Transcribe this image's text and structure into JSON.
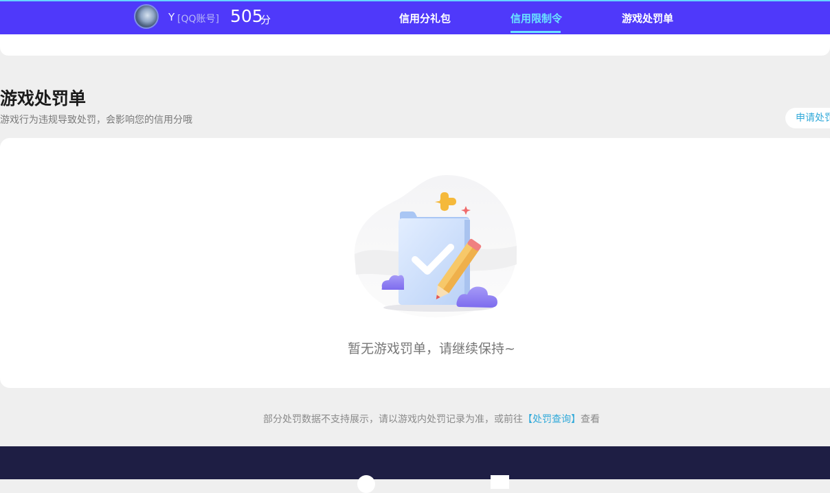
{
  "header": {
    "username": "Y",
    "account_type": "[QQ账号]",
    "score": "505",
    "score_unit": "分",
    "nav": [
      {
        "label": "信用分礼包",
        "active": false
      },
      {
        "label": "信用限制令",
        "active": true
      },
      {
        "label": "游戏处罚单",
        "active": false
      }
    ]
  },
  "section": {
    "title": "游戏处罚单",
    "subtitle": "游戏行为违规导致处罚，会影响您的信用分哦",
    "apply_button": "申请处罚"
  },
  "empty_state": {
    "message": "暂无游戏罚单，请继续保持~",
    "illustration_icon": "clipboard-check-pencil-icon"
  },
  "note": {
    "prefix": "部分处罚数据不支持展示，请以游戏内处罚记录为准，或前往",
    "link": "【处罚查询】",
    "suffix": "查看"
  },
  "colors": {
    "header_bg": "#4f39fa",
    "active_nav": "#69e2ff",
    "link": "#30a9d9",
    "footer_bg": "#1e1e44"
  }
}
